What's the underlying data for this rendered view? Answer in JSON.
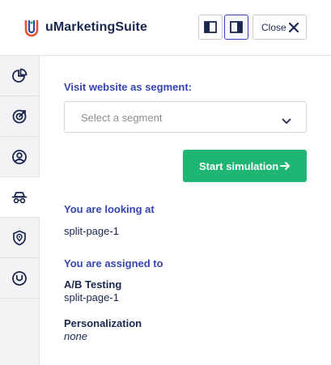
{
  "header": {
    "app_title": "uMarketingSuite",
    "layout_left_icon": "panel-left-icon",
    "layout_right_icon": "panel-right-icon",
    "close_label": "Close",
    "close_icon": "close-icon"
  },
  "sidebar": {
    "items": [
      {
        "icon": "pie-chart-icon",
        "active": false
      },
      {
        "icon": "target-icon",
        "active": false
      },
      {
        "icon": "user-profile-icon",
        "active": false
      },
      {
        "icon": "incognito-icon",
        "active": true
      },
      {
        "icon": "shield-location-icon",
        "active": false
      },
      {
        "icon": "umbraco-icon",
        "active": false
      }
    ]
  },
  "simulation": {
    "segment_label": "Visit website as segment:",
    "segment_placeholder": "Select a segment",
    "start_button_label": "Start simulation"
  },
  "looking_at": {
    "heading": "You are looking at",
    "value": "split-page-1"
  },
  "assigned": {
    "heading": "You are assigned to",
    "ab_testing_label": "A/B Testing",
    "ab_testing_value": "split-page-1",
    "personalization_label": "Personalization",
    "personalization_value": "none"
  },
  "colors": {
    "accent_blue": "#3544b1",
    "primary_green": "#1fb572",
    "text_dark": "#1b264f",
    "sidebar_bg": "#f3f3f5"
  }
}
